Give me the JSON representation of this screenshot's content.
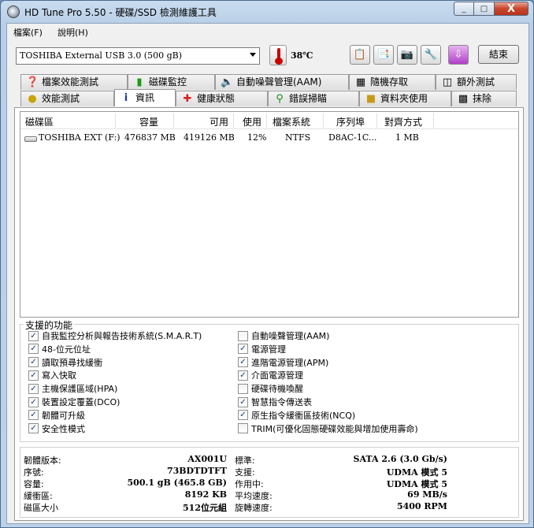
{
  "window": {
    "title": "HD Tune Pro 5.50 - 硬碟/SSD 檢測維護工具",
    "min": "_",
    "max": "□",
    "close": "X"
  },
  "menu": {
    "file": "檔案(F)",
    "help": "說明(H)"
  },
  "toolbar": {
    "drive": "TOSHIBA External USB 3.0 (500 gB)",
    "temperature": "38℃",
    "exit": "結束",
    "icons": [
      "copy-icon",
      "copy-info-icon",
      "camera-icon",
      "options-icon",
      "save-icon"
    ]
  },
  "tabs": {
    "row1": [
      {
        "label": "檔案效能測試",
        "icon": "file-benchmark-icon"
      },
      {
        "label": "磁碟監控",
        "icon": "disk-monitor-icon"
      },
      {
        "label": "自動噪聲管理(AAM)",
        "icon": "speaker-icon"
      },
      {
        "label": "隨機存取",
        "icon": "random-access-icon"
      },
      {
        "label": "額外測試",
        "icon": "extra-tests-icon"
      }
    ],
    "row2": [
      {
        "label": "效能測試",
        "icon": "lightbulb-icon"
      },
      {
        "label": "資訊",
        "icon": "info-icon"
      },
      {
        "label": "健康狀態",
        "icon": "health-cross-icon"
      },
      {
        "label": "錯誤掃瞄",
        "icon": "magnifier-icon"
      },
      {
        "label": "資料夾使用",
        "icon": "folder-icon"
      },
      {
        "label": "抹除",
        "icon": "trash-icon"
      }
    ]
  },
  "partition_list": {
    "headers": [
      "磁碟區",
      "容量",
      "可用",
      "使用",
      "檔案系統",
      "序列埠",
      "對齊方式"
    ],
    "rows": [
      {
        "volume": "TOSHIBA EXT (F:)",
        "capacity": "476837 MB",
        "free": "419126 MB",
        "usage": "12%",
        "fs": "NTFS",
        "serial": "D8AC-1C...",
        "alignment": "1 MB"
      }
    ]
  },
  "features": {
    "title": "支援的功能",
    "left": [
      {
        "label": "自我監控分析與報告技術系統(S.M.A.R.T)",
        "checked": true
      },
      {
        "label": "48-位元位址",
        "checked": true
      },
      {
        "label": "讀取預尋找緩衝",
        "checked": true
      },
      {
        "label": "寫入快取",
        "checked": true
      },
      {
        "label": "主機保護區域(HPA)",
        "checked": true
      },
      {
        "label": "裝置設定覆蓋(DCO)",
        "checked": true
      },
      {
        "label": "韌體可升級",
        "checked": true
      },
      {
        "label": "安全性模式",
        "checked": true
      }
    ],
    "right": [
      {
        "label": "自動噪聲管理(AAM)",
        "checked": false
      },
      {
        "label": "電源管理",
        "checked": true
      },
      {
        "label": "進階電源管理(APM)",
        "checked": true
      },
      {
        "label": "介面電源管理",
        "checked": true
      },
      {
        "label": "硬碟待機喚醒",
        "checked": false
      },
      {
        "label": "智慧指令傳送表",
        "checked": true
      },
      {
        "label": "原生指令緩衝區技術(NCQ)",
        "checked": true
      },
      {
        "label": "TRIM(可優化固態硬碟效能與增加使用壽命)",
        "checked": false
      }
    ]
  },
  "info": {
    "left": [
      {
        "label": "韌體版本:",
        "value": "AX001U"
      },
      {
        "label": "序號:",
        "value": "73BDTDTFT"
      },
      {
        "label": "容量:",
        "value": "500.1 gB (465.8 GB)"
      },
      {
        "label": "緩衝區:",
        "value": "8192 KB"
      },
      {
        "label": "磁區大小",
        "value": "512位元組"
      }
    ],
    "right": [
      {
        "label": "標準:",
        "value": "SATA 2.6 (3.0 Gb/s)"
      },
      {
        "label": "支援:",
        "value": "UDMA 模式 5"
      },
      {
        "label": "作用中:",
        "value": "UDMA 模式 5"
      },
      {
        "label": "平均速度:",
        "value": "69 MB/s"
      },
      {
        "label": "旋轉速度:",
        "value": "5400 RPM"
      }
    ]
  }
}
